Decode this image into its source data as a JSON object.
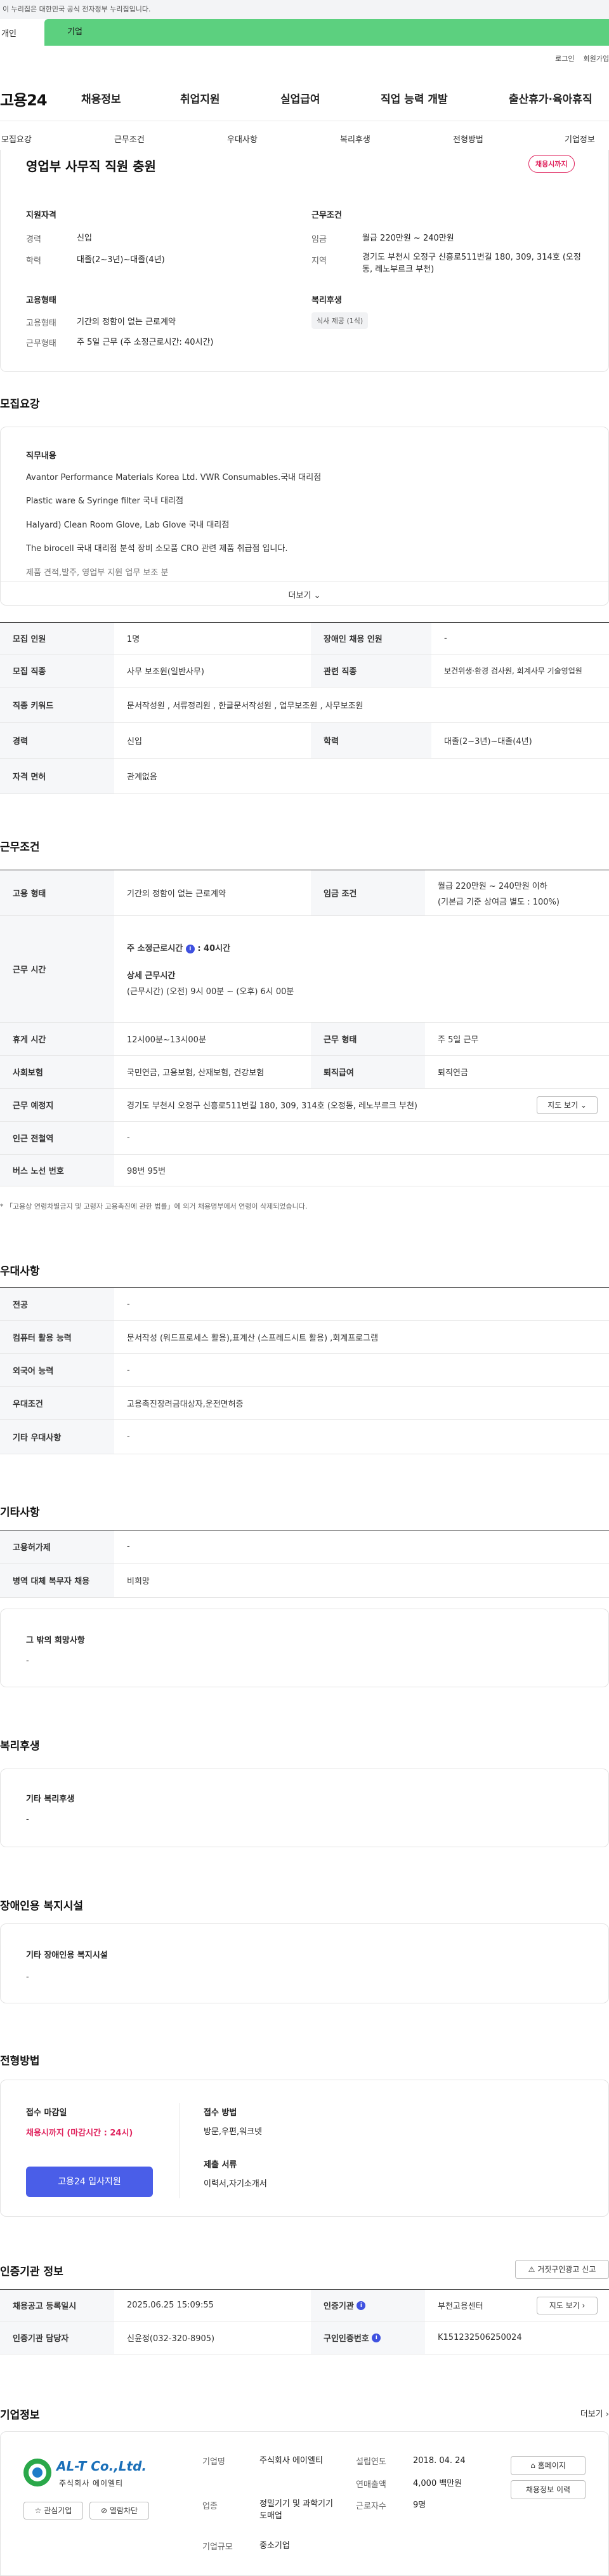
{
  "gov_banner": "이 누리집은 대한민국 공식 전자정부 누리집입니다.",
  "tabs": [
    "개인",
    "기업"
  ],
  "util": {
    "login": "로그인",
    "join": "회원가입"
  },
  "gnb": {
    "logo": "고용24",
    "items": [
      "채용정보",
      "취업지원",
      "실업급여",
      "직업 능력 개발",
      "출산휴가·육아휴직"
    ]
  },
  "snb": [
    "모집요강",
    "근무조건",
    "우대사항",
    "복리후생",
    "전형방법",
    "기업정보"
  ],
  "summary": {
    "title": "영업부 사무직 직원 충원",
    "badge": "채용시까지",
    "qual_title": "지원자격",
    "career_label": "경력",
    "career": "신입",
    "edu_label": "학력",
    "edu": "대졸(2~3년)~대졸(4년)",
    "cond_title": "근무조건",
    "wage_label": "임금",
    "wage": "월급 220만원 ~ 240만원",
    "region_label": "지역",
    "region": "경기도 부천시 오정구 신흥로511번길 180, 309, 314호 (오정동, 레노부르크 부천)",
    "emp_title": "고용형태",
    "emp_label": "고용형태",
    "emp": "기간의 정함이 없는 근로계약",
    "work_label": "근무형태",
    "work": "주 5일 근무 (주 소정근로시간: 40시간)",
    "welfare_title": "복리후생",
    "welfare_chip": "식사 제공 (1식)"
  },
  "recruit": {
    "title": "모집요강",
    "duty_title": "직무내용",
    "lines": [
      "Avantor Performance Materials Korea Ltd. VWR  Consumables.국내 대리점",
      "Plastic ware & Syringe filter 국내 대리점",
      "Halyard) Clean Room Glove, Lab Glove 국내 대리점",
      "The birocell 국내 대리점  분석 장비 소모품 CRO 관련 제품  취급점 입니다.",
      "제품 견적,발주, 영업부 지원 업무 보조 분"
    ],
    "more": "더보기"
  },
  "recruit_table": {
    "r1": {
      "th1": "모집 인원",
      "td1": "1명",
      "th2": "장애인 채용 인원",
      "td2": "-"
    },
    "r2": {
      "th1": "모집 직종",
      "td1": "사무 보조원(일반사무)",
      "th2": "관련 직종",
      "td2": "보건위생·환경 검사원, 회계사무 기술영업원"
    },
    "r3": {
      "th1": "직종 키워드",
      "td1": "문서작성원 , 서류정리원 , 한글문서작성원 , 업무보조원 , 사무보조원"
    },
    "r4": {
      "th1": "경력",
      "td1": "신입",
      "th2": "학력",
      "td2": "대졸(2~3년)~대졸(4년)"
    },
    "r5": {
      "th1": "자격 면허",
      "td1": "관계없음"
    }
  },
  "conditions": {
    "title": "근무조건",
    "r1": {
      "th1": "고용 형태",
      "td1": "기간의 정함이 없는 근로계약",
      "th2": "임금 조건",
      "td2a": "월급 220만원 ~ 240만원 이하",
      "td2b": "(기본급 기준 상여금 별도 : 100%)"
    },
    "r2": {
      "th1": "근무 시간",
      "std_label": "주 소정근로시간",
      "std_val": ": 40시간",
      "detail_label": "상세 근무시간",
      "detail_val": "(근무시간) (오전) 9시 00분 ~ (오후) 6시 00분"
    },
    "r3": {
      "th1": "휴게 시간",
      "td1": "12시00분~13시00분",
      "th2": "근무 형태",
      "td2": "주 5일 근무"
    },
    "r4": {
      "th1": "사회보험",
      "td1": "국민연금, 고용보험, 산재보험, 건강보험",
      "th2": "퇴직급여",
      "td2": "퇴직연금"
    },
    "r5": {
      "th1": "근무 예정지",
      "td1": "경기도 부천시 오정구 신흥로511번길 180, 309, 314호 (오정동, 레노부르크 부천)",
      "btn": "지도 보기"
    },
    "r6": {
      "th1": "인근 전철역",
      "td1": "-"
    },
    "r7": {
      "th1": "버스 노선 번호",
      "td1": "98번 95번"
    },
    "note": "* 「고용상 연령차별금지 및 고령자 고용촉진에 관한 법률」에 의거 채용명부에서 연령이 삭제되었습니다."
  },
  "pref": {
    "title": "우대사항",
    "r1": {
      "th": "전공",
      "td": "-"
    },
    "r2": {
      "th": "컴퓨터 활용 능력",
      "td": "문서작성 (워드프로세스 활용),표계산 (스프레드시트 활용) ,회계프로그램"
    },
    "r3": {
      "th": "외국어 능력",
      "td": "-"
    },
    "r4": {
      "th": "우대조건",
      "td": "고용촉진장려금대상자,운전면허증"
    },
    "r5": {
      "th": "기타 우대사항",
      "td": "-"
    }
  },
  "etc": {
    "title": "기타사항",
    "r1": {
      "th": "고용허가제",
      "td": "-"
    },
    "r2": {
      "th": "병역 대체 복무자 채용",
      "td": "비희망"
    },
    "hope_title": "그 밖의 희망사항",
    "hope": "-"
  },
  "benefit": {
    "title": "복리후생",
    "box_title": "기타 복리후생",
    "box_val": "-"
  },
  "disab": {
    "title": "장애인용 복지시설",
    "box_title": "기타 장애인용 복지시설",
    "box_val": "-"
  },
  "selection": {
    "title": "전형방법",
    "deadline_label": "접수 마감일",
    "deadline": "채용시까지 (마감시간 : 24시)",
    "apply_btn": "고용24 입사지원",
    "method_label": "접수 방법",
    "method": "방문,우편,워크넷",
    "docs_label": "제출 서류",
    "docs": "이력서,자기소개서"
  },
  "cert": {
    "title": "인증기관 정보",
    "report_btn": "거짓구인광고 신고",
    "r1": {
      "th1": "채용공고 등록일시",
      "td1": "2025.06.25 15:09:55",
      "th2": "인증기관",
      "td2": "부천고용센터",
      "btn": "지도 보기"
    },
    "r2": {
      "th1": "인증기관 담당자",
      "td1": "신윤정(032-320-8905)",
      "th2": "구인인증번호",
      "td2": "K151232506250024"
    }
  },
  "company": {
    "title": "기업정보",
    "more": "더보기",
    "logo_text": "AL-T Co.,Ltd.",
    "logo_sub": "주식회사 에이엘티",
    "fav_btn": "관심기업",
    "block_btn": "열람차단",
    "name_label": "기업명",
    "name": "주식회사 에이엘티",
    "industry_label": "업종",
    "industry": "정밀기기 및 과학기기 도매업",
    "size_label": "기업규모",
    "size": "중소기업",
    "founded_label": "설립연도",
    "founded": "2018. 04. 24",
    "sales_label": "연매출액",
    "sales": "4,000 백만원",
    "staff_label": "근로자수",
    "staff": "9명",
    "home_btn": "홈페이지",
    "jobs_btn": "채용정보 이력"
  },
  "colors": {
    "brand_green": "#5cd07f",
    "accent_blue": "#4a5ee8",
    "red": "#e0245e"
  }
}
